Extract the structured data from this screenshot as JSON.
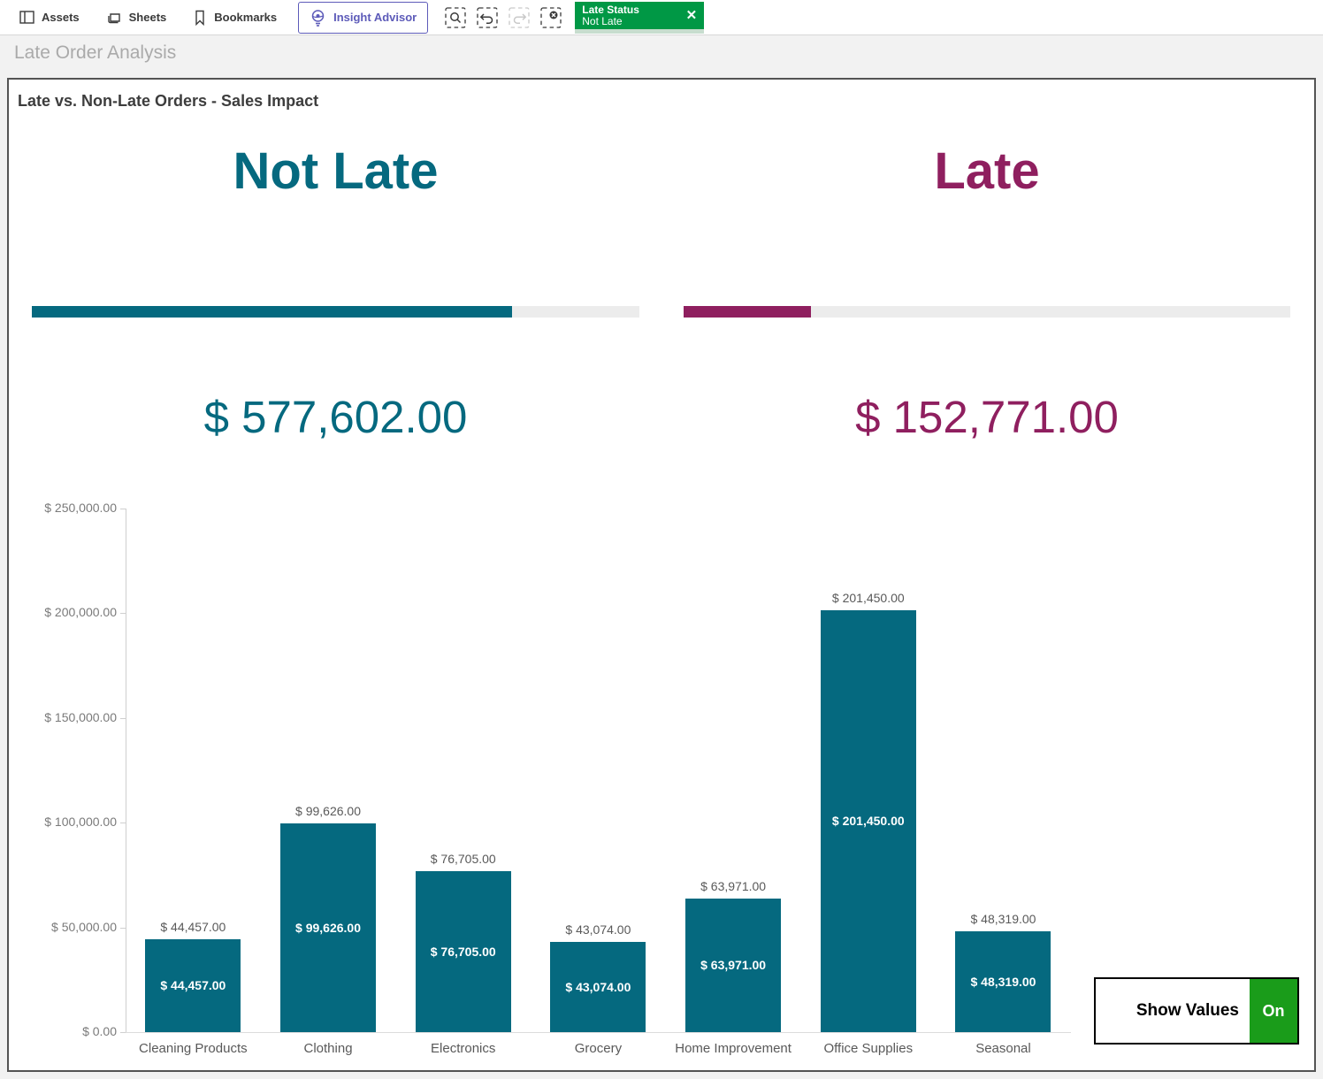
{
  "toolbar": {
    "assets_label": "Assets",
    "sheets_label": "Sheets",
    "bookmarks_label": "Bookmarks",
    "insight_advisor_label": "Insight Advisor",
    "selection_chip": {
      "field": "Late Status",
      "value": "Not Late",
      "close_glyph": "✕",
      "fill_pct": 55,
      "chip_color": "#009845"
    }
  },
  "sheet_title": "Late Order Analysis",
  "panel_title": "Late vs. Non-Late Orders - Sales Impact",
  "kpis": [
    {
      "label": "Not Late",
      "value": "$ 577,602.00",
      "progress_pct": 79,
      "color": "#05697f"
    },
    {
      "label": "Late",
      "value": "$ 152,771.00",
      "progress_pct": 21,
      "color": "#8f1f5f"
    }
  ],
  "chart_data": {
    "type": "bar",
    "title": "Late vs. Non-Late Orders - Sales Impact",
    "categories": [
      "Cleaning Products",
      "Clothing",
      "Electronics",
      "Grocery",
      "Home Improvement",
      "Office Supplies",
      "Seasonal"
    ],
    "values": [
      44457,
      99626,
      76705,
      43074,
      63971,
      201450,
      48319
    ],
    "value_labels": [
      "$ 44,457.00",
      "$ 99,626.00",
      "$ 76,705.00",
      "$ 43,074.00",
      "$ 63,971.00",
      "$ 201,450.00",
      "$ 48,319.00"
    ],
    "xlabel": "",
    "ylabel": "",
    "ylim": [
      0,
      250000
    ],
    "ytick_values": [
      250000,
      200000,
      150000,
      100000,
      50000,
      0
    ],
    "ytick_labels": [
      "$ 250,000.00",
      "$ 200,000.00",
      "$ 150,000.00",
      "$ 100,000.00",
      "$ 50,000.00",
      "$ 0.00"
    ],
    "bar_color": "#05697f",
    "grid": false,
    "legend": false
  },
  "show_values_button": {
    "label": "Show Values",
    "state": "On",
    "on_color": "#1a9c1a"
  }
}
